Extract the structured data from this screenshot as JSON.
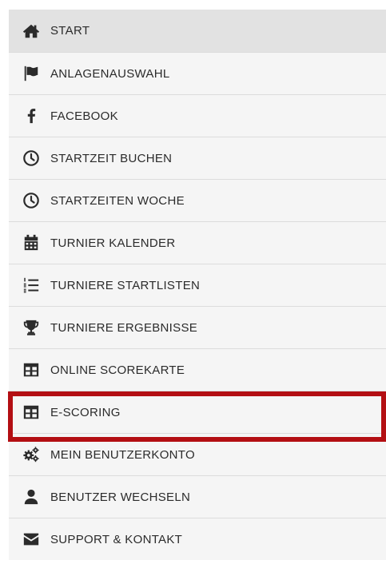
{
  "menu": {
    "items": [
      {
        "label": "START",
        "icon": "home-icon"
      },
      {
        "label": "ANLAGENAUSWAHL",
        "icon": "flag-icon"
      },
      {
        "label": "FACEBOOK",
        "icon": "facebook-icon"
      },
      {
        "label": "STARTZEIT BUCHEN",
        "icon": "clock-icon"
      },
      {
        "label": "STARTZEITEN WOCHE",
        "icon": "clock-icon"
      },
      {
        "label": "TURNIER KALENDER",
        "icon": "calendar-icon"
      },
      {
        "label": "TURNIERE STARTLISTEN",
        "icon": "ordered-list-icon"
      },
      {
        "label": "TURNIERE ERGEBNISSE",
        "icon": "trophy-icon"
      },
      {
        "label": "ONLINE SCOREKARTE",
        "icon": "table-icon"
      },
      {
        "label": "E-SCORING",
        "icon": "table-icon"
      },
      {
        "label": "MEIN BENUTZERKONTO",
        "icon": "gears-icon"
      },
      {
        "label": "BENUTZER WECHSELN",
        "icon": "user-icon"
      },
      {
        "label": "SUPPORT & KONTAKT",
        "icon": "envelope-icon"
      }
    ],
    "highlighted_item": "E-SCORING",
    "highlight_color": "#b30f13",
    "icon_color": "#2b2b2b"
  }
}
